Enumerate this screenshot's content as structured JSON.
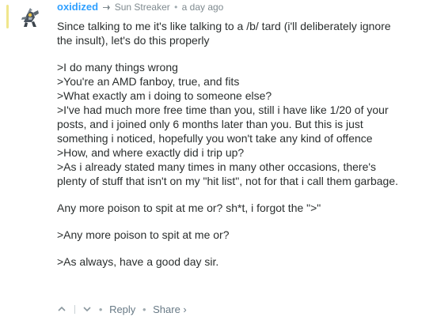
{
  "comment": {
    "author": "oxidized",
    "reply_to": "Sun Streaker",
    "timestamp": "a day ago",
    "paragraphs": [
      [
        "Since talking to me it's like talking to a /b/ tard (i'll deliberately ignore",
        "the insult), let's do this properly"
      ],
      [
        ">I do many things wrong",
        ">You're an AMD fanboy, true, and fits",
        ">What exactly am i doing to someone else?",
        ">I've had much more free time than you, still i have like 1/20 of your",
        "posts, and i joined only 6 months later than you. But this is just",
        "something i noticed, hopefully you won't take any kind of offence",
        ">How, and where exactly did i trip up?",
        ">As i already stated many times in many other occasions, there's",
        "plenty of stuff that isn't on my \"hit list\", not for that i call them garbage."
      ],
      [
        "Any more poison to spit at me or? sh*t, i forgot the \">\""
      ],
      [
        ">Any more poison to spit at me or?"
      ],
      [
        ">As always, have a good day sir."
      ]
    ]
  },
  "footer": {
    "reply_label": "Reply",
    "share_label": "Share ›"
  },
  "colors": {
    "author": "#2e9fff",
    "accent_bar": "#f0e68c",
    "meta": "#7f8a8f",
    "text": "#2a2e2e"
  },
  "icons": {
    "reply_to": "reply-arrow-icon",
    "upvote": "chevron-up-icon",
    "downvote": "chevron-down-icon"
  }
}
